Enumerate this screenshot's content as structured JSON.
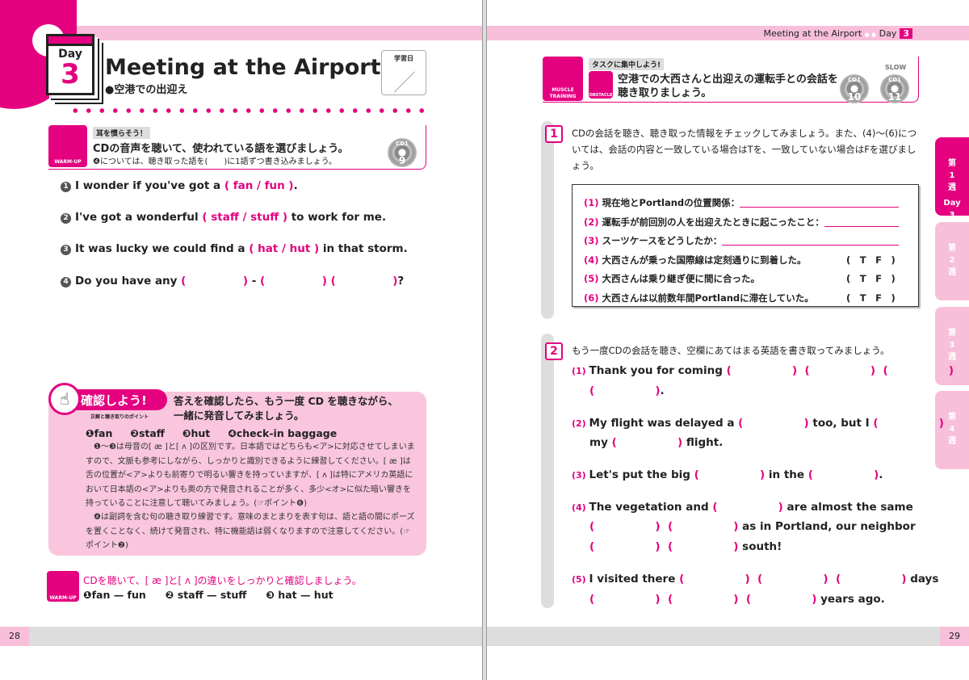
{
  "left": {
    "page_number": "28",
    "day_label": "Day",
    "day_number": "3",
    "title": "Meeting at the Airport",
    "subtitle": "●空港での出迎え",
    "study_date_label": "学習日",
    "warmup": {
      "icon": "listening-ear-icon",
      "icon_label": "WARM-UP",
      "tag": "耳を慣らそう！",
      "heading": "CDの音声を聴いて、使われている語を選びましょう。",
      "note": "❹については、聴き取った語を(　　)に1語ずつ書き込みましょう。",
      "cd": {
        "disc": "CD1",
        "track": "9"
      }
    },
    "questions": [
      {
        "num": "1",
        "parts": [
          [
            "t",
            "I wonder if you've got a "
          ],
          [
            "b",
            "( fan / fun )"
          ],
          [
            "t",
            "."
          ]
        ]
      },
      {
        "num": "2",
        "parts": [
          [
            "t",
            "I've got a wonderful "
          ],
          [
            "b",
            "( staff / stuff )"
          ],
          [
            "t",
            " to work for me."
          ]
        ]
      },
      {
        "num": "3",
        "parts": [
          [
            "t",
            "It was lucky we could find a "
          ],
          [
            "b",
            "( hat / hut )"
          ],
          [
            "t",
            " in that storm."
          ]
        ]
      },
      {
        "num": "4",
        "parts": [
          [
            "t",
            "Do you have any "
          ],
          [
            "b",
            "(               )"
          ],
          [
            "t",
            " - "
          ],
          [
            "b",
            "(               ) (               )"
          ],
          [
            "t",
            "?"
          ]
        ]
      }
    ],
    "kakunin": {
      "badge": "確認しよう!",
      "badge_sub": "正解と聴き取りのポイント",
      "heading1": "答えを確認したら、もう一度 CD を聴きながら、",
      "heading2": "一緒に発音してみましょう。",
      "answers": [
        "❶fan",
        "❷staff",
        "❸hut",
        "❹check-in baggage"
      ],
      "para1": "　❶〜❸は母音の[ æ ]と[ ʌ ]の区別です。日本語ではどちらも<ア>に対応させてしまいますので、文脈も参考にしながら、しっかりと識別できるように練習してください。[ æ ]は舌の位置が<ア>よりも前寄りで明るい響きを持っていますが、[ ʌ ]は特にアメリカ英語において日本語の<ア>よりも奥の方で発音されることが多く、多少<オ>に似た暗い響きを持っていることに注意して聴いてみましょう。(☞ポイント❻)",
      "para2": "　❹は副詞を含む句の聴き取り練習です。意味のまとまりを表す句は、語と語の間にポーズを置くことなく、続けて発音され、特に機能語は弱くなりますので注意してください。(☞ポイント❷)"
    },
    "warmup2": {
      "icon": "smiling-face-icon",
      "icon_label": "WARM-UP",
      "heading": "CDを聴いて、[ æ ]と[ ʌ ]の違いをしっかりと確認しましょう。",
      "pairs": [
        "❶fan — fun",
        "❷ staff — stuff",
        "❸ hat — hut"
      ]
    }
  },
  "right": {
    "page_number": "29",
    "header": {
      "title": "Meeting at the Airport",
      "dots": "● ●",
      "day": "Day",
      "day_number": "3"
    },
    "muscle": {
      "icon": "muscle-arm-icon",
      "icon_label": "MUSCLE TRAINING",
      "tag": "タスクに集中しよう!",
      "obstacle_icon": "hurdle-icon",
      "obstacle_label": "OBSTACLE",
      "heading1": "空港での大西さんと出迎えの運転手との会話を",
      "heading2": "聴き取りましょう。",
      "cds": [
        {
          "disc": "CD1",
          "track": "10"
        },
        {
          "disc": "CD1",
          "track": "11",
          "label": "SLOW"
        }
      ]
    },
    "section1": {
      "num": "1",
      "instruction": "CDの会話を聴き、聴き取った情報をチェックしてみましょう。また、(4)〜(6)については、会話の内容と一致している場合はTを、一致していない場合はFを選びましょう。",
      "items": [
        {
          "n": "(1)",
          "text": "現在地とPortlandの位置関係：",
          "line": true
        },
        {
          "n": "(2)",
          "text": "運転手が前回別の人を出迎えたときに起こったこと：",
          "line": true
        },
        {
          "n": "(3)",
          "text": "スーツケースをどうしたか：",
          "line": true
        },
        {
          "n": "(4)",
          "text": "大西さんが乗った国際線は定刻通りに到着した。",
          "tf": "(　T　F　)"
        },
        {
          "n": "(5)",
          "text": "大西さんは乗り継ぎ便に間に合った。",
          "tf": "(　T　F　)"
        },
        {
          "n": "(6)",
          "text": "大西さんは以前数年間Portlandに滞在していた。",
          "tf": "(　T　F　)"
        }
      ]
    },
    "section2": {
      "num": "2",
      "instruction": "もう一度CDの会話を聴き、空欄にあてはまる英語を書き取ってみましょう。",
      "lines": [
        {
          "n": "(1)",
          "parts": [
            [
              "t",
              "Thank you for coming "
            ],
            [
              "b",
              "(                )  (                )  (                )"
            ]
          ]
        },
        {
          "parts": [
            [
              "b",
              "(                )"
            ],
            [
              "t",
              "."
            ]
          ]
        },
        {
          "n": "(2)",
          "parts": [
            [
              "t",
              "My flight was delayed a "
            ],
            [
              "b",
              "(                )"
            ],
            [
              "t",
              " too, but I "
            ],
            [
              "b",
              "(                )"
            ]
          ]
        },
        {
          "parts": [
            [
              "t",
              "my "
            ],
            [
              "b",
              "(                )"
            ],
            [
              "t",
              " flight."
            ]
          ]
        },
        {
          "n": "(3)",
          "parts": [
            [
              "t",
              "Let's put the big "
            ],
            [
              "b",
              "(                )"
            ],
            [
              "t",
              " in the "
            ],
            [
              "b",
              "(                )"
            ],
            [
              "t",
              "."
            ]
          ]
        },
        {
          "n": "(4)",
          "parts": [
            [
              "t",
              "The vegetation and "
            ],
            [
              "b",
              "(                )"
            ],
            [
              "t",
              " are almost the same"
            ]
          ]
        },
        {
          "parts": [
            [
              "b",
              "(                )  (                )"
            ],
            [
              "t",
              " as in Portland, our neighbor"
            ]
          ]
        },
        {
          "parts": [
            [
              "b",
              "(                )  (                )"
            ],
            [
              "t",
              " south!"
            ]
          ]
        },
        {
          "n": "(5)",
          "parts": [
            [
              "t",
              "I visited there "
            ],
            [
              "b",
              "(                )  (                )  (                )"
            ],
            [
              "t",
              " days"
            ]
          ]
        },
        {
          "parts": [
            [
              "b",
              "(                )  (                )  (                )"
            ],
            [
              "t",
              " years ago."
            ]
          ]
        }
      ]
    },
    "tabs": [
      {
        "label": "第\n1\n週",
        "sub": "Day\n3",
        "active": true
      },
      {
        "label": "第\n2\n週"
      },
      {
        "label": "第\n3\n週"
      },
      {
        "label": "第\n4\n週"
      }
    ]
  },
  "colors": {
    "accent": "#e4007f",
    "light_pink": "#f7bfd9",
    "box_pink": "#f9c6de"
  }
}
